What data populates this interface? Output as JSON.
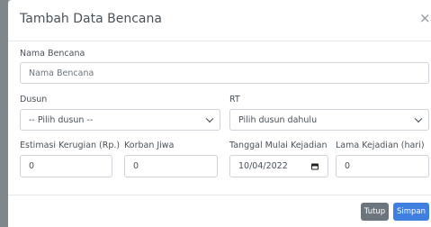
{
  "modal": {
    "title": "Tambah Data Bencana",
    "close_symbol": "×"
  },
  "form": {
    "nama_bencana": {
      "label": "Nama Bencana",
      "placeholder": "Nama Bencana"
    },
    "dusun": {
      "label": "Dusun",
      "selected": "-- Pilih dusun --"
    },
    "rt": {
      "label": "RT",
      "selected": "Pilih dusun dahulu"
    },
    "estimasi_kerugian": {
      "label": "Estimasi Kerugian (Rp.)",
      "value": "0"
    },
    "korban_jiwa": {
      "label": "Korban Jiwa",
      "value": "0"
    },
    "tanggal_mulai": {
      "label": "Tanggal Mulai Kejadian",
      "value": "10/04/2022"
    },
    "lama_kejadian": {
      "label": "Lama Kejadian (hari)",
      "value": "0"
    }
  },
  "footer": {
    "close_label": "Tutup",
    "save_label": "Simpan"
  },
  "icons": {
    "close": "close-icon",
    "select_arrow": "chevron-down-icon",
    "date_picker": "calendar-icon"
  },
  "colors": {
    "save_button": "#3e7fe0",
    "close_button": "#6c757d"
  }
}
